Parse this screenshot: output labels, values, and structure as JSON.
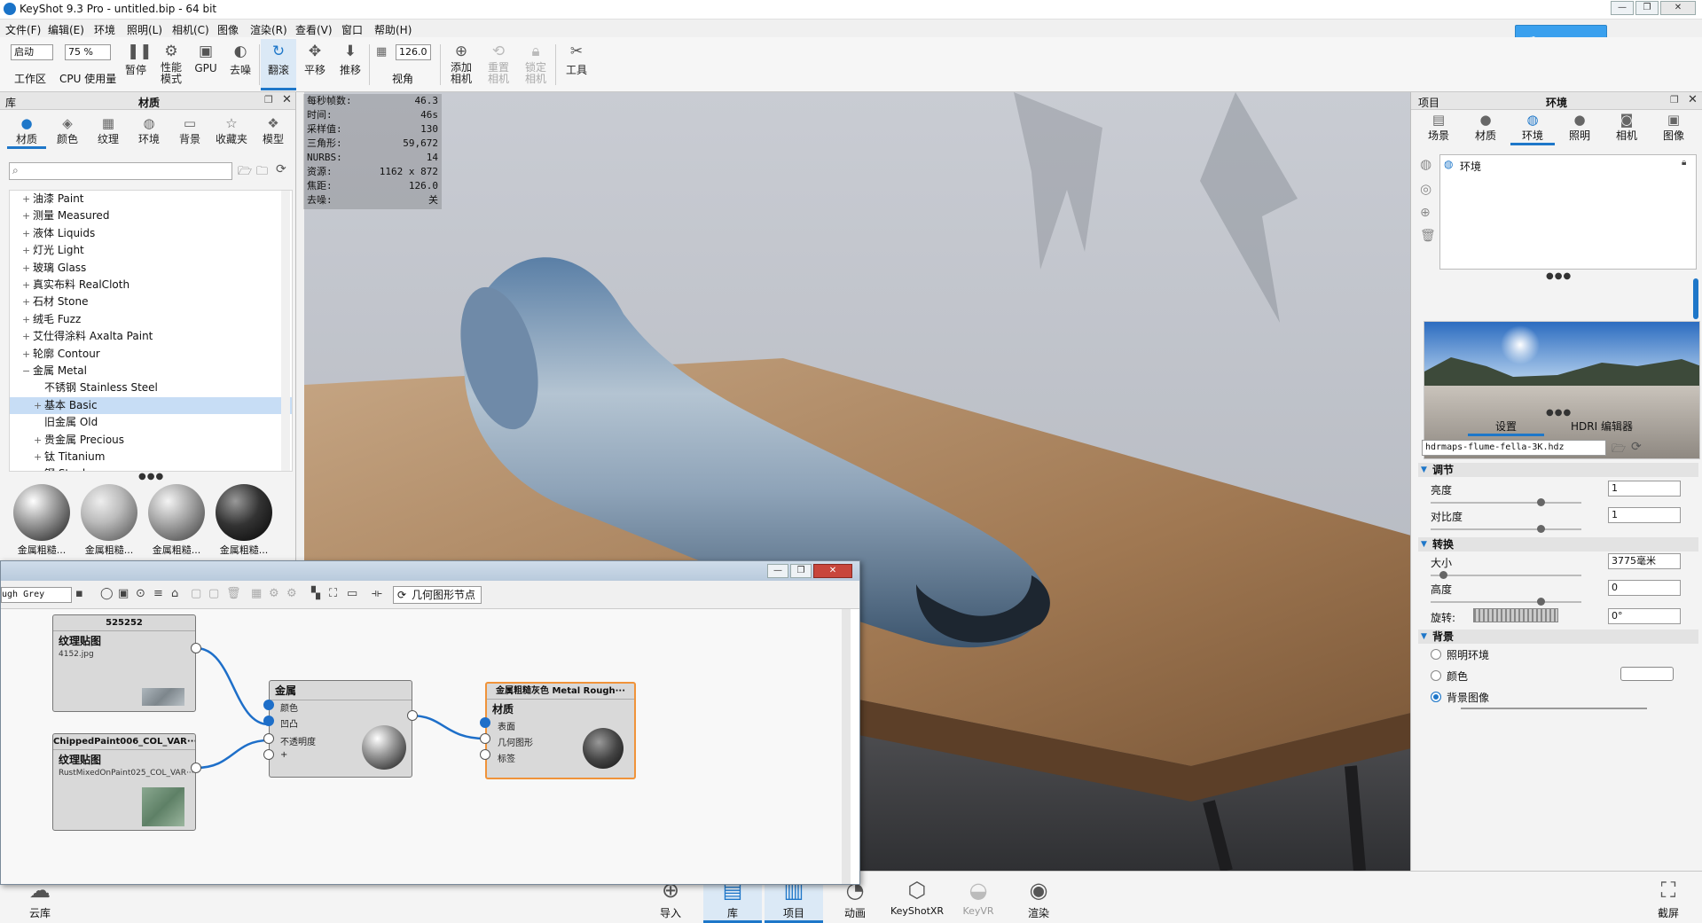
{
  "app": {
    "title": "KeyShot 9.3 Pro  - untitled.bip  - 64 bit"
  },
  "menu": [
    "文件(F)",
    "编辑(E)",
    "环境",
    "照明(L)",
    "相机(C)",
    "图像",
    "渲染(R)",
    "查看(V)",
    "窗口",
    "帮助(H)"
  ],
  "toolbar": {
    "workspace_value": "启动",
    "workspace_label": "工作区",
    "cpu_value": "75 %",
    "cpu_label": "CPU 使用量",
    "pause": "暂停",
    "perf_mode": "性能\n模式",
    "gpu": "GPU",
    "denoise": "去噪",
    "tumble": "翻滚",
    "pan": "平移",
    "dolly": "推移",
    "fov_value": "126.0",
    "fov_label": "视角",
    "add_camera": "添加\n相机",
    "reset_camera": "重置\n相机",
    "lock_camera": "锁定\n相机",
    "tools": "工具",
    "cloud_button": "​"
  },
  "library": {
    "title": "库",
    "panel": "材质",
    "tabs": [
      "材质",
      "颜色",
      "纹理",
      "环境",
      "背景",
      "收藏夹",
      "模型"
    ],
    "tree": [
      {
        "label": "油漆 Paint",
        "pm": "+",
        "indent": 0
      },
      {
        "label": "测量 Measured",
        "pm": "+",
        "indent": 0
      },
      {
        "label": "液体 Liquids",
        "pm": "+",
        "indent": 0
      },
      {
        "label": "灯光 Light",
        "pm": "+",
        "indent": 0
      },
      {
        "label": "玻璃 Glass",
        "pm": "+",
        "indent": 0
      },
      {
        "label": "真实布料 RealCloth",
        "pm": "+",
        "indent": 0
      },
      {
        "label": "石材 Stone",
        "pm": "+",
        "indent": 0
      },
      {
        "label": "绒毛 Fuzz",
        "pm": "+",
        "indent": 0
      },
      {
        "label": "艾仕得涂料 Axalta Paint",
        "pm": "+",
        "indent": 0
      },
      {
        "label": "轮廓 Contour",
        "pm": "+",
        "indent": 0
      },
      {
        "label": "金属 Metal",
        "pm": "−",
        "indent": 0
      },
      {
        "label": "不锈钢 Stainless Steel",
        "pm": "",
        "indent": 1
      },
      {
        "label": "基本 Basic",
        "pm": "+",
        "indent": 1,
        "selected": true
      },
      {
        "label": "旧金属 Old",
        "pm": "",
        "indent": 1
      },
      {
        "label": "贵金属 Precious",
        "pm": "+",
        "indent": 1
      },
      {
        "label": "钛 Titanium",
        "pm": "+",
        "indent": 1
      },
      {
        "label": "钢 Steel",
        "pm": "+",
        "indent": 1
      }
    ],
    "thumbs": [
      "金属粗糙...",
      "金属粗糙...",
      "金属粗糙...",
      "金属粗糙..."
    ]
  },
  "hud": [
    {
      "k": "每秒帧数:",
      "v": "46.3"
    },
    {
      "k": "时间:",
      "v": "46s"
    },
    {
      "k": "采样值:",
      "v": "130"
    },
    {
      "k": "三角形:",
      "v": "59,672"
    },
    {
      "k": "NURBS:",
      "v": "14"
    },
    {
      "k": "资源:",
      "v": "1162 x 872"
    },
    {
      "k": "焦距:",
      "v": "126.0"
    },
    {
      "k": "去噪:",
      "v": "关"
    }
  ],
  "project": {
    "title": "项目",
    "panel": "环境",
    "tabs": [
      "场景",
      "材质",
      "环境",
      "照明",
      "相机",
      "图像"
    ],
    "env_item": "环境",
    "subtabs": [
      "设置",
      "HDRI 编辑器"
    ],
    "hdr_file": "hdrmaps-flume-fella-3K.hdz",
    "adjust": {
      "head": "调节",
      "brightness_label": "亮度",
      "brightness": "1",
      "contrast_label": "对比度",
      "contrast": "1"
    },
    "transform": {
      "head": "转换",
      "size_label": "大小",
      "size": "3775毫米",
      "height_label": "高度",
      "height": "0",
      "rotate_label": "旋转:",
      "rotate": "0°"
    },
    "background": {
      "head": "背景",
      "opt1": "照明环境",
      "opt2": "颜色",
      "opt3": "背景图像",
      "selected": "背景图像"
    }
  },
  "bottom": {
    "cloud": "云库",
    "import": "导入",
    "library": "库",
    "project": "项目",
    "animation": "动画",
    "keyshotxr": "KeyShotXR",
    "keyvr": "KeyVR",
    "render": "渲染",
    "screenshot": "截屏"
  },
  "graph": {
    "material_name": "ugh Grey",
    "geometry_node_btn": "几何图形节点",
    "node1": {
      "header": "525252",
      "title": "纹理贴图",
      "sub": "4152.jpg"
    },
    "node2": {
      "header": "ChippedPaint006_COL_VAR···",
      "title": "纹理贴图",
      "sub": "RustMixedOnPaint025_COL_VAR···"
    },
    "metal": {
      "title": "金属",
      "ports": [
        "颜色",
        "凹凸",
        "不透明度",
        "+"
      ]
    },
    "material": {
      "header": "金属粗糙灰色 Metal Rough···",
      "title": "材质",
      "ports": [
        "表面",
        "几何图形",
        "标签"
      ]
    }
  }
}
